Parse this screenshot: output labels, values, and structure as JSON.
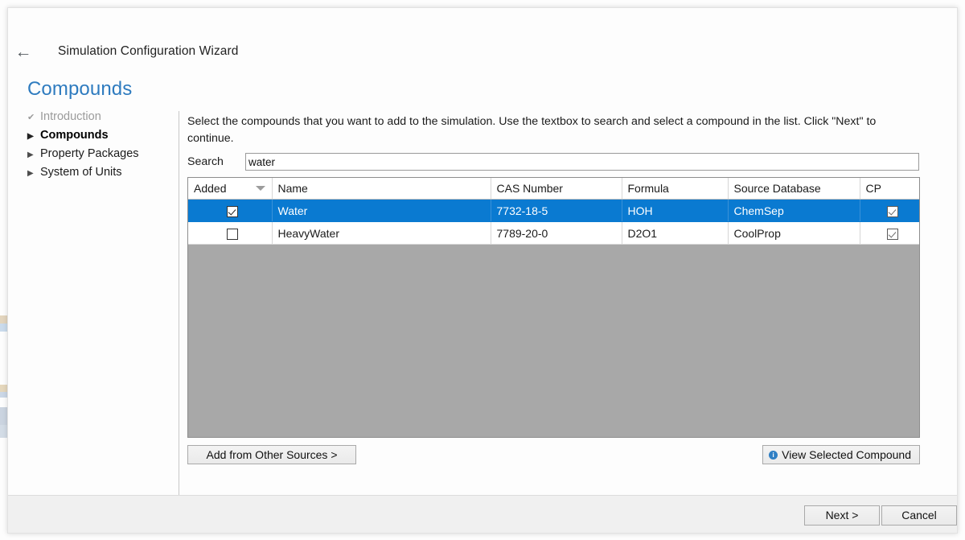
{
  "window": {
    "back_icon": "←",
    "title": "Simulation Configuration Wizard",
    "page_heading": "Compounds"
  },
  "sidebar": {
    "items": [
      {
        "label": "Introduction",
        "marker": "✔",
        "state": "done"
      },
      {
        "label": "Compounds",
        "marker": "▶",
        "state": "current"
      },
      {
        "label": "Property Packages",
        "marker": "▶",
        "state": "normal"
      },
      {
        "label": "System of Units",
        "marker": "▶",
        "state": "normal"
      }
    ]
  },
  "content": {
    "instructions": "Select the compounds that you want to add to the simulation. Use the textbox to search and select a compound in the list. Click \"Next\" to continue.",
    "search": {
      "label": "Search",
      "value": "water",
      "placeholder": ""
    },
    "grid": {
      "columns": [
        "Added",
        "Name",
        "CAS Number",
        "Formula",
        "Source Database",
        "CP"
      ],
      "sorted_column": "Added",
      "sort_direction": "descending",
      "rows": [
        {
          "added": true,
          "name": "Water",
          "cas_number": "7732-18-5",
          "formula": "HOH",
          "source_database": "ChemSep",
          "cp": true,
          "selected": true
        },
        {
          "added": false,
          "name": "HeavyWater",
          "cas_number": "7789-20-0",
          "formula": "D2O1",
          "source_database": "CoolProp",
          "cp": true,
          "selected": false
        }
      ]
    },
    "buttons": {
      "add_from_other_sources": "Add from Other Sources >",
      "view_selected_compound": "View Selected Compound",
      "view_selected_icon": "i"
    }
  },
  "footer": {
    "next_label": "Next >",
    "cancel_label": "Cancel"
  },
  "colors": {
    "heading": "#2e7bbf",
    "selection": "#0a7ad1",
    "grid_empty": "#a8a8a8",
    "footer_bg": "#f0f0f0",
    "info_icon": "#2f7fc4"
  }
}
